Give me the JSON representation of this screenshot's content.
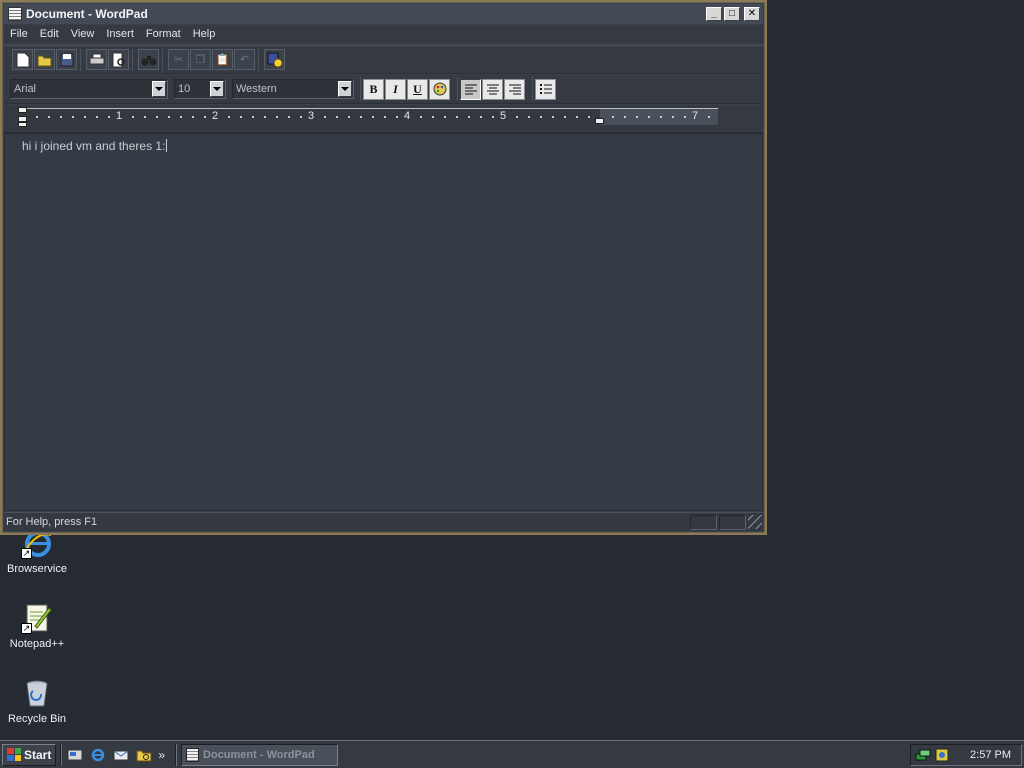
{
  "window": {
    "title": "Document - WordPad",
    "controls": {
      "minimize": "_",
      "maximize": "□",
      "close": "✕"
    }
  },
  "menu": [
    "File",
    "Edit",
    "View",
    "Insert",
    "Format",
    "Help"
  ],
  "toolbar": {
    "buttons": [
      {
        "name": "new-icon"
      },
      {
        "name": "open-icon"
      },
      {
        "name": "save-icon"
      },
      {
        "name": "print-icon"
      },
      {
        "name": "print-preview-icon"
      },
      {
        "name": "find-icon"
      },
      {
        "name": "cut-icon"
      },
      {
        "name": "copy-icon"
      },
      {
        "name": "paste-icon"
      },
      {
        "name": "undo-icon"
      },
      {
        "name": "date-time-icon"
      }
    ]
  },
  "format_bar": {
    "font": "Arial",
    "size": "10",
    "script": "Western",
    "bold": "B",
    "italic": "I",
    "underline": "U",
    "alignment": "left"
  },
  "ruler": {
    "numbers": [
      "1",
      "2",
      "3",
      "4",
      "5",
      "7"
    ]
  },
  "document": {
    "text": "hi i joined vm and theres 1:"
  },
  "status": {
    "text": "For Help, press F1"
  },
  "desktop_icons": [
    {
      "label": "Browservice",
      "icon": "browser-icon"
    },
    {
      "label": "Notepad++",
      "icon": "notepad-plus-plus-icon"
    },
    {
      "label": "Recycle Bin",
      "icon": "recycle-bin-icon"
    }
  ],
  "taskbar": {
    "start_label": "Start",
    "quick_launch": [
      "show-desktop-icon",
      "ie-icon",
      "outlook-icon",
      "explorer-icon"
    ],
    "overflow": "»",
    "tasks": [
      {
        "label": "Document - WordPad"
      }
    ],
    "clock": "2:57 PM"
  },
  "colors": {
    "desktop": "#262b33",
    "window_border": "#8a7a55",
    "taskbar": "#343942"
  }
}
